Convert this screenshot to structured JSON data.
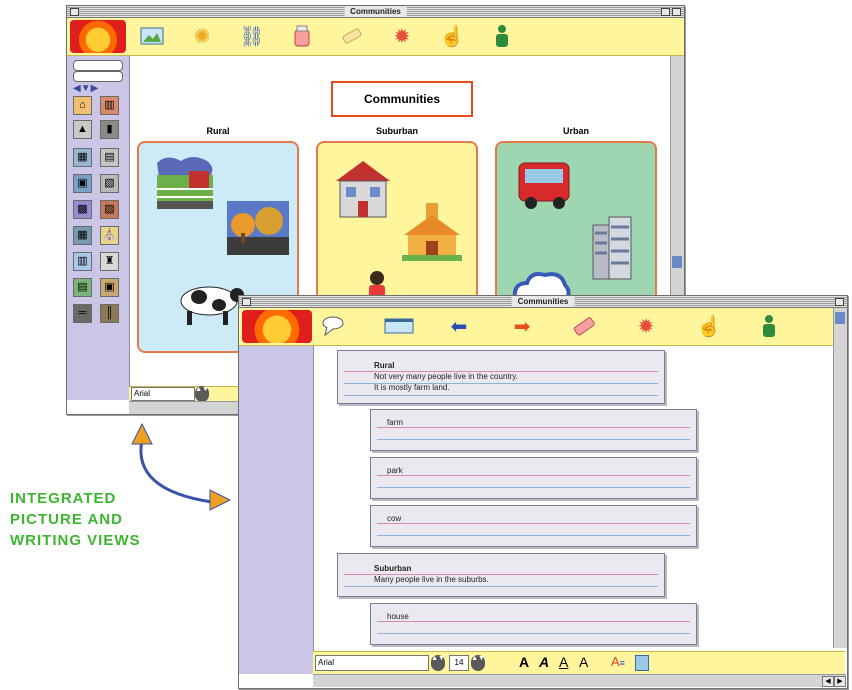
{
  "picture_window": {
    "title": "Communities",
    "toolbar_icons": [
      "logo-icon",
      "picture-icon",
      "sun-icon",
      "link-icon",
      "paint-jar-icon",
      "eraser-icon",
      "speaker-icon",
      "hand-icon",
      "person-icon"
    ],
    "heading": "Communities",
    "columns": [
      {
        "label": "Rural",
        "color": "#cdebf6",
        "pictures": [
          "farm-barn-icon",
          "orchard-icon",
          "cow-icon"
        ]
      },
      {
        "label": "Suburban",
        "color": "#fff59d",
        "pictures": [
          "house-icon",
          "schoolhouse-icon",
          "girl-icon"
        ]
      },
      {
        "label": "Urban",
        "color": "#9fd6b2",
        "pictures": [
          "bus-icon",
          "skyscraper-icon",
          "cloud-icon"
        ]
      }
    ],
    "font_name": "Arial"
  },
  "writing_window": {
    "title": "Communities",
    "toolbar_icons": [
      "logo-icon",
      "speech-icon",
      "window-icon",
      "left-arrow-icon",
      "right-arrow-icon",
      "eraser-icon",
      "speaker-icon",
      "hand-icon",
      "person-icon"
    ],
    "boxes": [
      {
        "heading": "Rural",
        "lines": [
          "Not very many people live in the country.",
          "It is mostly farm land."
        ]
      },
      {
        "label": "farm"
      },
      {
        "label": "park"
      },
      {
        "label": "cow"
      },
      {
        "heading": "Suburban",
        "lines": [
          "Many people live in the suburbs."
        ]
      },
      {
        "label": "house"
      }
    ],
    "status": {
      "font_name": "Arial",
      "font_size": "14",
      "style_buttons": [
        "A",
        "A",
        "A",
        "A"
      ],
      "tail_icons": [
        "text-color-icon",
        "copy-icon"
      ]
    }
  },
  "callout": {
    "lines": [
      "INTEGRATED",
      "PICTURE AND",
      "WRITING VIEWS"
    ]
  }
}
